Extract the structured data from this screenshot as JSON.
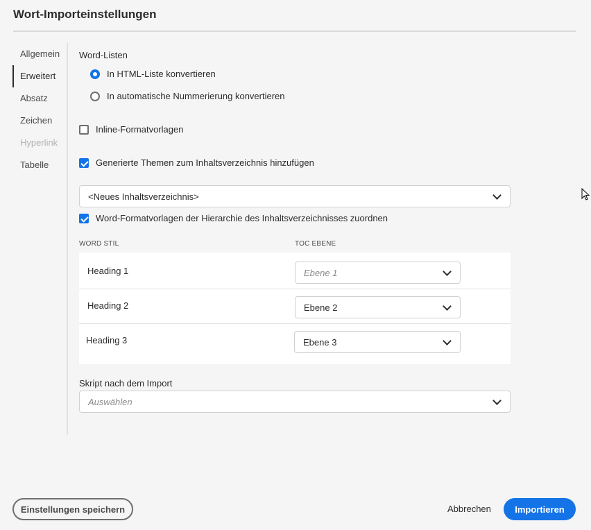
{
  "dialog": {
    "title": "Wort-Importeinstellungen"
  },
  "sidebar": {
    "items": [
      {
        "label": "Allgemein",
        "state": "normal"
      },
      {
        "label": "Erweitert",
        "state": "active"
      },
      {
        "label": "Absatz",
        "state": "normal"
      },
      {
        "label": "Zeichen",
        "state": "normal"
      },
      {
        "label": "Hyperlink",
        "state": "disabled"
      },
      {
        "label": "Tabelle",
        "state": "normal"
      }
    ]
  },
  "word_lists": {
    "heading": "Word-Listen",
    "options": [
      {
        "label": "In HTML-Liste konvertieren",
        "selected": true
      },
      {
        "label": "In automatische Nummerierung konvertieren",
        "selected": false
      }
    ]
  },
  "inline_styles": {
    "label": "Inline-Formatvorlagen",
    "checked": false
  },
  "generated_topics": {
    "label": "Generierte Themen zum Inhaltsverzeichnis hinzufügen",
    "checked": true
  },
  "toc_select": {
    "value": "<Neues Inhaltsverzeichnis>"
  },
  "map_styles": {
    "label": "Word-Formatvorlagen der Hierarchie des Inhaltsverzeichnisses zuordnen",
    "checked": true
  },
  "mapping_table": {
    "col_word_style": "WORD STIL",
    "col_toc_level": "TOC EBENE",
    "rows": [
      {
        "word_style": "Heading 1",
        "toc_level": "Ebene 1",
        "placeholder": true
      },
      {
        "word_style": "Heading 2",
        "toc_level": "Ebene 2",
        "placeholder": false
      },
      {
        "word_style": "Heading 3",
        "toc_level": "Ebene 3",
        "placeholder": false
      }
    ]
  },
  "post_import_script": {
    "label": "Skript nach dem Import",
    "placeholder": "Auswählen"
  },
  "footer": {
    "save_settings": "Einstellungen speichern",
    "cancel": "Abbrechen",
    "import": "Importieren"
  },
  "colors": {
    "accent": "#1473e6",
    "background": "#f5f5f5"
  }
}
